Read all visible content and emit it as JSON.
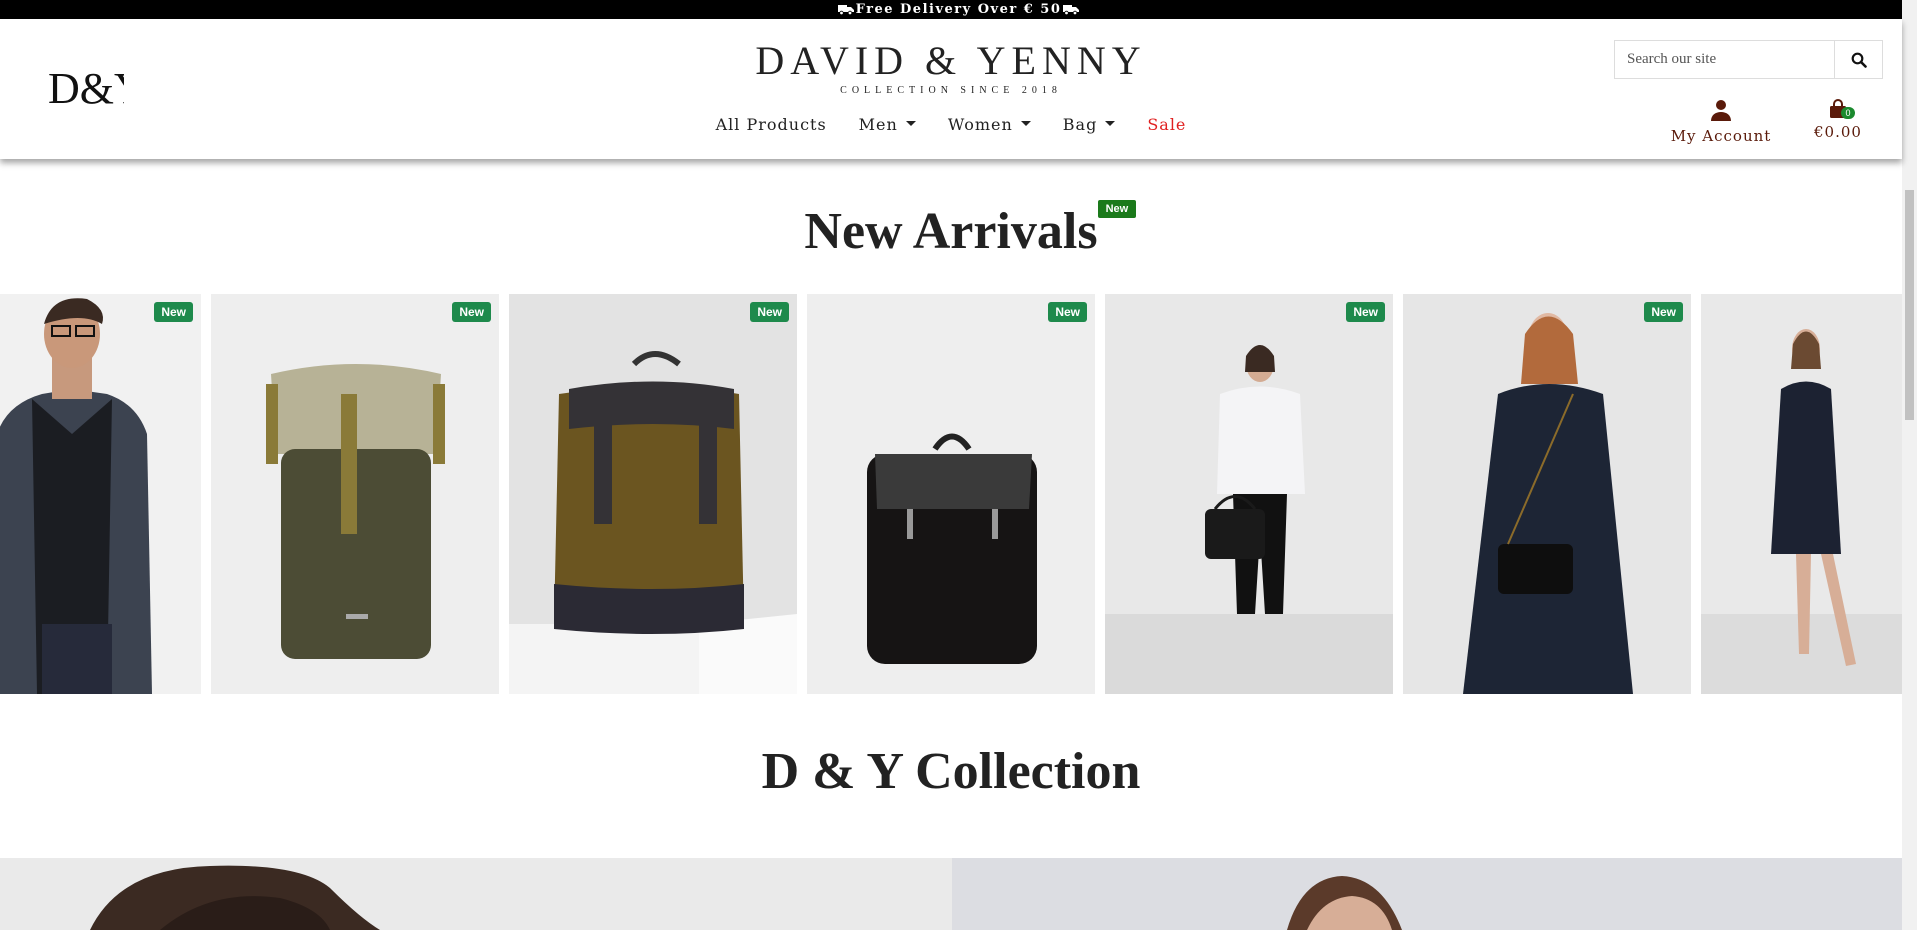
{
  "banner": {
    "text": "Free Delivery Over € 50",
    "icon_left": "truck-icon",
    "icon_right": "truck-icon"
  },
  "header": {
    "logo_text": "D&Y",
    "brand_name": "DAVID & YENNY",
    "brand_tagline": "COLLECTION SINCE 2018",
    "nav": [
      {
        "label": "All Products",
        "dropdown": false
      },
      {
        "label": "Men",
        "dropdown": true
      },
      {
        "label": "Women",
        "dropdown": true
      },
      {
        "label": "Bag",
        "dropdown": true
      },
      {
        "label": "Sale",
        "dropdown": false,
        "color": "#e02020"
      }
    ],
    "search": {
      "placeholder": "Search our site",
      "icon": "search-icon"
    },
    "account": {
      "label": "My Account",
      "icon": "user-icon"
    },
    "cart": {
      "total": "€0.00",
      "count": "0",
      "icon": "shopping-bag-icon"
    }
  },
  "new_arrivals": {
    "title": "New Arrivals",
    "title_badge": "New",
    "products": [
      {
        "badge": "New",
        "subject": "man in grey blazer"
      },
      {
        "badge": "New",
        "subject": "olive roll-top backpack"
      },
      {
        "badge": "New",
        "subject": "brown canvas backpack"
      },
      {
        "badge": "New",
        "subject": "black backpack"
      },
      {
        "badge": "New",
        "subject": "woman with black handbag"
      },
      {
        "badge": "New",
        "subject": "woman with crossbody bag"
      },
      {
        "badge": "",
        "subject": "woman in navy dress"
      }
    ]
  },
  "collection": {
    "title": "D & Y Collection"
  },
  "colors": {
    "accent_red": "#e02020",
    "badge_green": "#1e8a4c",
    "account_brown": "#5a1a0a"
  }
}
